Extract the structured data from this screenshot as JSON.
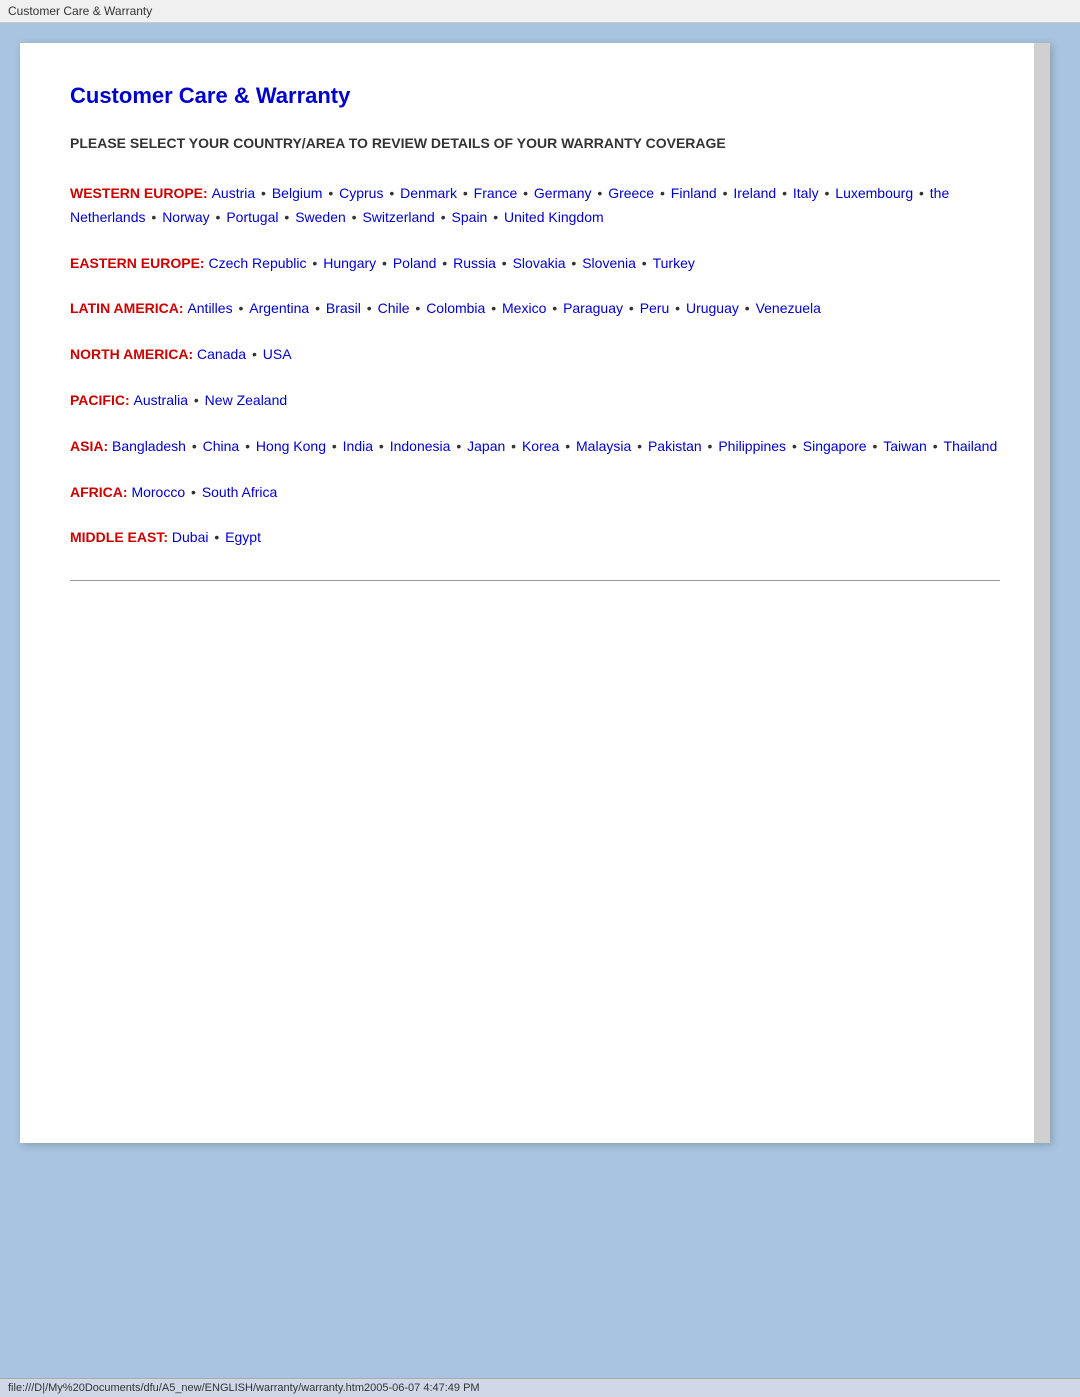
{
  "titleBar": {
    "label": "Customer Care & Warranty"
  },
  "page": {
    "title": "Customer Care & Warranty",
    "subtitle": "PLEASE SELECT YOUR COUNTRY/AREA TO REVIEW DETAILS OF YOUR WARRANTY COVERAGE"
  },
  "regions": [
    {
      "id": "western-europe",
      "label": "WESTERN EUROPE:",
      "countries": [
        "Austria",
        "Belgium",
        "Cyprus",
        "Denmark",
        "France",
        "Germany",
        "Greece",
        "Finland",
        "Ireland",
        "Italy",
        "Luxembourg",
        "the Netherlands",
        "Norway",
        "Portugal",
        "Sweden",
        "Switzerland",
        "Spain",
        "United Kingdom"
      ]
    },
    {
      "id": "eastern-europe",
      "label": "EASTERN EUROPE:",
      "countries": [
        "Czech Republic",
        "Hungary",
        "Poland",
        "Russia",
        "Slovakia",
        "Slovenia",
        "Turkey"
      ]
    },
    {
      "id": "latin-america",
      "label": "LATIN AMERICA:",
      "countries": [
        "Antilles",
        "Argentina",
        "Brasil",
        "Chile",
        "Colombia",
        "Mexico",
        "Paraguay",
        "Peru",
        "Uruguay",
        "Venezuela"
      ]
    },
    {
      "id": "north-america",
      "label": "NORTH AMERICA:",
      "countries": [
        "Canada",
        "USA"
      ]
    },
    {
      "id": "pacific",
      "label": "PACIFIC:",
      "countries": [
        "Australia",
        "New Zealand"
      ]
    },
    {
      "id": "asia",
      "label": "ASIA:",
      "countries": [
        "Bangladesh",
        "China",
        "Hong Kong",
        "India",
        "Indonesia",
        "Japan",
        "Korea",
        "Malaysia",
        "Pakistan",
        "Philippines",
        "Singapore",
        "Taiwan",
        "Thailand"
      ]
    },
    {
      "id": "africa",
      "label": "AFRICA:",
      "countries": [
        "Morocco",
        "South Africa"
      ]
    },
    {
      "id": "middle-east",
      "label": "MIDDLE EAST:",
      "countries": [
        "Dubai",
        "Egypt"
      ]
    }
  ],
  "statusBar": {
    "text": "file:///D|/My%20Documents/dfu/A5_new/ENGLISH/warranty/warranty.htm2005-06-07 4:47:49 PM"
  }
}
